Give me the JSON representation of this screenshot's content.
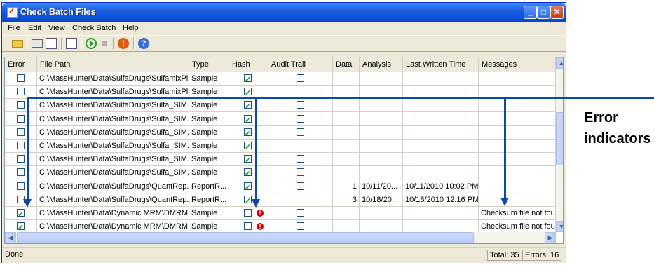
{
  "window": {
    "title": "Check Batch Files"
  },
  "menu": [
    "File",
    "Edit",
    "View",
    "Check Batch",
    "Help"
  ],
  "toolbar_icons": [
    "open-folder-icon",
    "print-icon",
    "print-preview-icon",
    "copy-icon",
    "run-icon",
    "stop-icon",
    "error-icon",
    "help-icon"
  ],
  "columns": [
    "Error",
    "File Path",
    "Type",
    "Hash",
    "Audit Trail",
    "Data",
    "Analysis",
    "Last Written Time",
    "Messages"
  ],
  "rows": [
    {
      "error": false,
      "path": "C:\\MassHunter\\Data\\SulfaDrugs\\SulfamixPl...",
      "type": "Sample",
      "hash": true,
      "hash_warn": false,
      "audit": false,
      "data": "",
      "analysis": "",
      "lwt": "",
      "message": ""
    },
    {
      "error": false,
      "path": "C:\\MassHunter\\Data\\SulfaDrugs\\SulfamixPl...",
      "type": "Sample",
      "hash": true,
      "hash_warn": false,
      "audit": false,
      "data": "",
      "analysis": "",
      "lwt": "",
      "message": ""
    },
    {
      "error": false,
      "path": "C:\\MassHunter\\Data\\SulfaDrugs\\Sulfa_SIM...",
      "type": "Sample",
      "hash": true,
      "hash_warn": false,
      "audit": false,
      "data": "",
      "analysis": "",
      "lwt": "",
      "message": ""
    },
    {
      "error": false,
      "path": "C:\\MassHunter\\Data\\SulfaDrugs\\Sulfa_SIM...",
      "type": "Sample",
      "hash": true,
      "hash_warn": false,
      "audit": false,
      "data": "",
      "analysis": "",
      "lwt": "",
      "message": ""
    },
    {
      "error": false,
      "path": "C:\\MassHunter\\Data\\SulfaDrugs\\Sulfa_SIM...",
      "type": "Sample",
      "hash": true,
      "hash_warn": false,
      "audit": false,
      "data": "",
      "analysis": "",
      "lwt": "",
      "message": ""
    },
    {
      "error": false,
      "path": "C:\\MassHunter\\Data\\SulfaDrugs\\Sulfa_SIM...",
      "type": "Sample",
      "hash": true,
      "hash_warn": false,
      "audit": false,
      "data": "",
      "analysis": "",
      "lwt": "",
      "message": ""
    },
    {
      "error": false,
      "path": "C:\\MassHunter\\Data\\SulfaDrugs\\Sulfa_SIM...",
      "type": "Sample",
      "hash": true,
      "hash_warn": false,
      "audit": false,
      "data": "",
      "analysis": "",
      "lwt": "",
      "message": ""
    },
    {
      "error": false,
      "path": "C:\\MassHunter\\Data\\SulfaDrugs\\Sulfa_SIM...",
      "type": "Sample",
      "hash": true,
      "hash_warn": false,
      "audit": false,
      "data": "",
      "analysis": "",
      "lwt": "",
      "message": ""
    },
    {
      "error": false,
      "path": "C:\\MassHunter\\Data\\SulfaDrugs\\QuantRep...",
      "type": "ReportR...",
      "hash": true,
      "hash_warn": false,
      "audit": false,
      "data": "1",
      "analysis": "10/11/20...",
      "lwt": "10/11/2010 10:02 PM",
      "message": ""
    },
    {
      "error": false,
      "path": "C:\\MassHunter\\Data\\SulfaDrugs\\QuantRep...",
      "type": "ReportR...",
      "hash": true,
      "hash_warn": false,
      "audit": false,
      "data": "3",
      "analysis": "10/18/20...",
      "lwt": "10/18/2010 12:16 PM",
      "message": ""
    },
    {
      "error": true,
      "path": "C:\\MassHunter\\Data\\Dynamic MRM\\DMRM...",
      "type": "Sample",
      "hash": false,
      "hash_warn": true,
      "audit": false,
      "data": "",
      "analysis": "",
      "lwt": "",
      "message": "Checksum file not found."
    },
    {
      "error": true,
      "path": "C:\\MassHunter\\Data\\Dynamic MRM\\DMRM...",
      "type": "Sample",
      "hash": false,
      "hash_warn": true,
      "audit": false,
      "data": "",
      "analysis": "",
      "lwt": "",
      "message": "Checksum file not found."
    }
  ],
  "status": {
    "text": "Done",
    "total": "Total: 35",
    "errors": "Errors: 16"
  },
  "annotation": {
    "line1": "Error",
    "line2": "indicators"
  },
  "colors": {
    "title_bar": "#0a4fd8",
    "annotation": "#0d4a9e",
    "error_mark": "#d40000"
  }
}
